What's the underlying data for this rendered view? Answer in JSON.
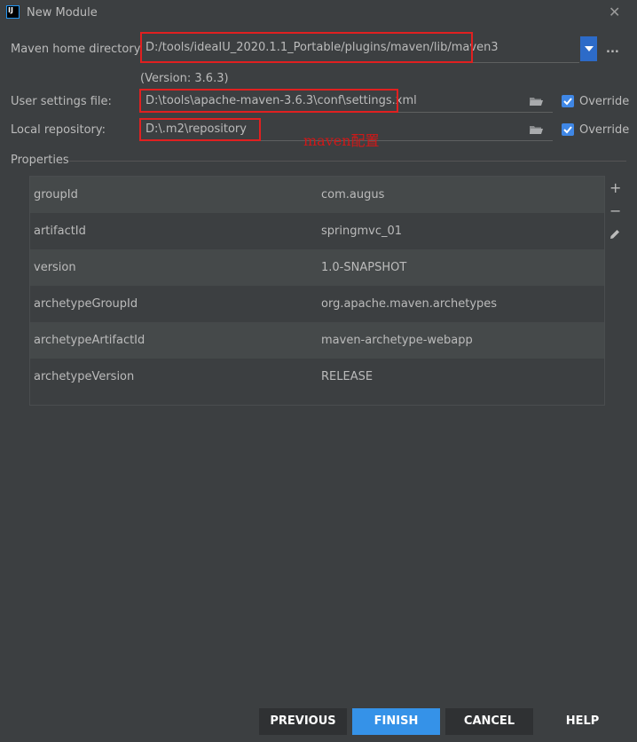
{
  "window": {
    "title": "New Module",
    "icon_text": "IJ",
    "close_glyph": "✕"
  },
  "maven": {
    "home_label": "Maven home directory:",
    "home_value": "D:/tools/ideaIU_2020.1.1_Portable/plugins/maven/lib/maven3",
    "more_glyph": "...",
    "version_text": "(Version: 3.6.3)",
    "settings_label": "User settings file:",
    "settings_value": "D:\\tools\\apache-maven-3.6.3\\conf\\settings.xml",
    "settings_override": "Override",
    "repo_label": "Local repository:",
    "repo_value": "D:\\.m2\\repository",
    "repo_override": "Override",
    "annotation": "maven配置"
  },
  "properties": {
    "header": "Properties",
    "rows": [
      {
        "key": "groupId",
        "value": "com.augus"
      },
      {
        "key": "artifactId",
        "value": "springmvc_01"
      },
      {
        "key": "version",
        "value": "1.0-SNAPSHOT"
      },
      {
        "key": "archetypeGroupId",
        "value": "org.apache.maven.archetypes"
      },
      {
        "key": "archetypeArtifactId",
        "value": "maven-archetype-webapp"
      },
      {
        "key": "archetypeVersion",
        "value": "RELEASE"
      }
    ],
    "add_glyph": "+",
    "remove_glyph": "−"
  },
  "footer": {
    "previous": "PREVIOUS",
    "finish": "FINISH",
    "cancel": "CANCEL",
    "help": "HELP"
  },
  "colors": {
    "background": "#3c3f41",
    "accent": "#3592e8",
    "highlight_border": "#e02020"
  }
}
